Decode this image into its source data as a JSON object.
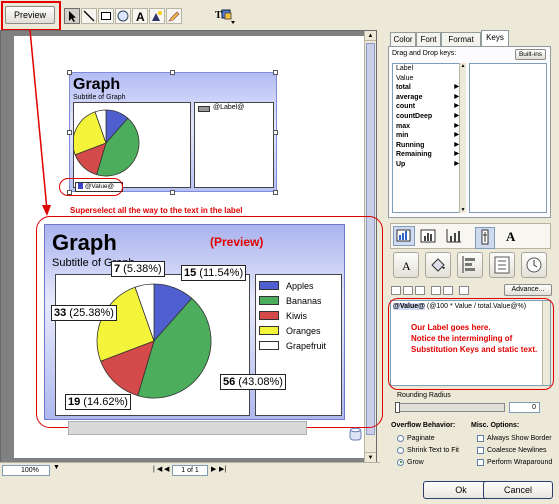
{
  "toolbar": {
    "preview_label": "Preview",
    "tools": [
      "pointer-tool-icon",
      "line-tool-icon",
      "rectangle-tool-icon",
      "ellipse-tool-icon",
      "text-tool-icon",
      "image-tool-icon",
      "pen-tool-icon"
    ],
    "insert_icon": "insert-field-icon"
  },
  "design_chart": {
    "title": "Graph",
    "subtitle": "Subtitle of Graph",
    "legend_label": "@Label@",
    "value_label": "@Value@"
  },
  "annotation": {
    "superselect": "Superselect all the way to the text in the label",
    "preview": "(Preview)",
    "label_note": "Our Label goes here.\nNotice the intermingling of Substitution Keys and static text."
  },
  "chart_data": {
    "type": "pie",
    "title": "Graph",
    "subtitle": "Subtitle of Graph",
    "categories": [
      "Apples",
      "Bananas",
      "Kiwis",
      "Oranges",
      "Grapefruit"
    ],
    "values": [
      15,
      56,
      19,
      33,
      7
    ],
    "percents": [
      "11.54%",
      "43.08%",
      "14.62%",
      "25.38%",
      "5.38%"
    ],
    "colors": [
      "#4f5fd0",
      "#4cae5c",
      "#d44a4a",
      "#f4f43a",
      "#ffffff"
    ],
    "legend": "right"
  },
  "panel": {
    "tabs": [
      "Color",
      "Font",
      "Format",
      "Keys"
    ],
    "active_tab": "Keys",
    "drag_label": "Drag and Drop keys:",
    "builtins_label": "Built-ins",
    "keys": [
      {
        "label": "Label",
        "bold": false,
        "arrow": false
      },
      {
        "label": "Value",
        "bold": false,
        "arrow": false
      },
      {
        "label": "total",
        "bold": true,
        "arrow": true
      },
      {
        "label": "average",
        "bold": true,
        "arrow": true
      },
      {
        "label": "count",
        "bold": true,
        "arrow": true
      },
      {
        "label": "countDeep",
        "bold": true,
        "arrow": true
      },
      {
        "label": "max",
        "bold": true,
        "arrow": true
      },
      {
        "label": "min",
        "bold": true,
        "arrow": true
      },
      {
        "label": "Running",
        "bold": true,
        "arrow": true
      },
      {
        "label": "Remaining",
        "bold": true,
        "arrow": true
      },
      {
        "label": "Up",
        "bold": true,
        "arrow": true
      }
    ],
    "advanced_label": "Advance...",
    "expr_key": "@Value@",
    "expr_rest": "(@100 * Value / total.Value@%)",
    "rounding_label": "Rounding Radius",
    "rounding_value": "0",
    "overflow_title": "Overflow Behavior:",
    "overflow_options": [
      "Paginate",
      "Shrink Text to Fit",
      "Grow"
    ],
    "overflow_selected": "Grow",
    "misc_title": "Misc. Options:",
    "misc_options": [
      "Always Show Border",
      "Coalesce Newlines",
      "Perform Wraparound"
    ]
  },
  "status": {
    "zoom": "100%",
    "page": "1 of 1"
  },
  "dialog": {
    "ok_label": "Ok",
    "cancel_label": "Cancel"
  }
}
